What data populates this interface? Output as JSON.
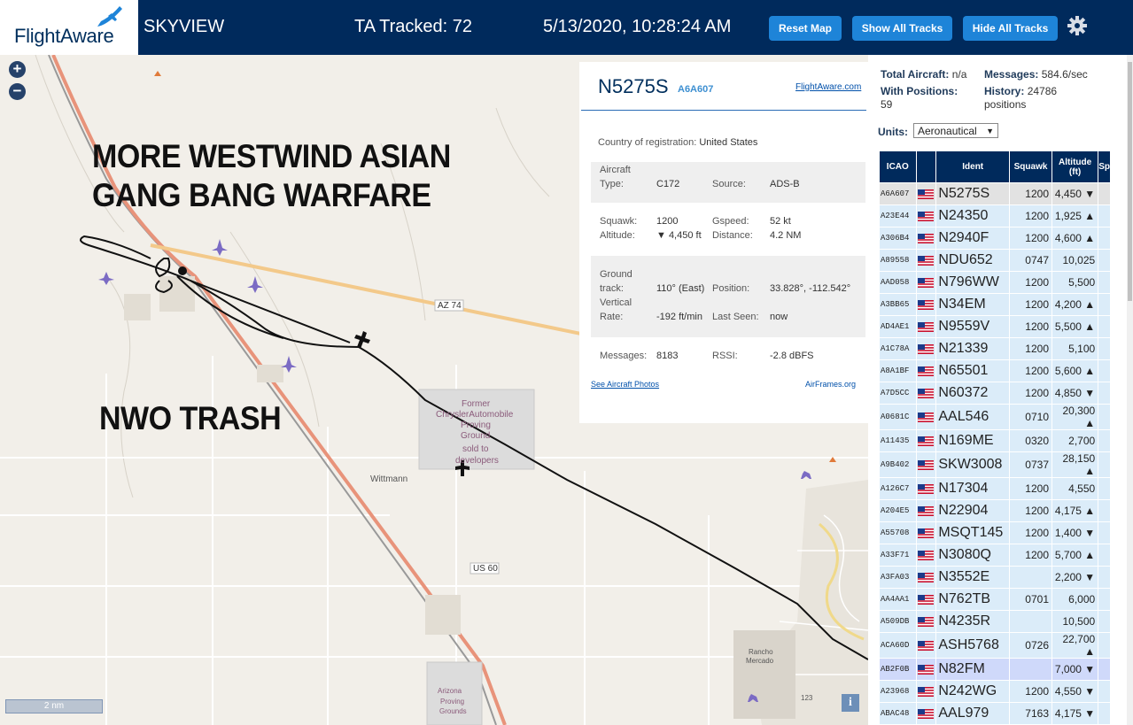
{
  "header": {
    "logo_text": "FlightAware",
    "app_name": "SKYVIEW",
    "tracked": "TA Tracked: 72",
    "datetime": "5/13/2020, 10:28:24 AM",
    "btn_reset": "Reset Map",
    "btn_show": "Show All Tracks",
    "btn_hide": "Hide All Tracks"
  },
  "map": {
    "overlay_line1": "MORE WESTWIND ASIAN",
    "overlay_line2": "GANG BANG WARFARE",
    "overlay_line3": "NWO TRASH",
    "labels": {
      "az74": "AZ 74",
      "us60": "US 60",
      "wittmann": "Wittmann",
      "former": "Former",
      "chrysler": "ChryslerAutomobile",
      "proving": "Proving",
      "ground": "Ground",
      "sold": "sold to",
      "devs": "developers",
      "rancho": "Rancho",
      "mercado": "Mercado",
      "arizona": "Arizona",
      "proving2": "Proving",
      "grounds": "Grounds",
      "rt123": "123"
    },
    "scale": "2 nm",
    "zoom_in": "+",
    "zoom_out": "−",
    "info": "i"
  },
  "detail": {
    "callsign": "N5275S",
    "hex": "A6A607",
    "fa_link": "FlightAware.com",
    "country_lbl": "Country of registration:",
    "country": "United States",
    "aircraft_lbl": "Aircraft",
    "type_lbl": "Type:",
    "type": "C172",
    "source_lbl": "Source:",
    "source": "ADS-B",
    "squawk_lbl": "Squawk:",
    "squawk": "1200",
    "gspeed_lbl": "Gspeed:",
    "gspeed": "52 kt",
    "altitude_lbl": "Altitude:",
    "altitude": "▼ 4,450 ft",
    "distance_lbl": "Distance:",
    "distance": "4.2 NM",
    "ground_lbl": "Ground",
    "track_lbl": "track:",
    "track": "110° (East)",
    "position_lbl": "Position:",
    "position": "33.828°, -112.542°",
    "vertical_lbl": "Vertical",
    "rate_lbl": "Rate:",
    "rate": "-192 ft/min",
    "lastseen_lbl": "Last Seen:",
    "lastseen": "now",
    "messages_lbl": "Messages:",
    "messages": "8183",
    "rssi_lbl": "RSSI:",
    "rssi": "-2.8 dBFS",
    "photos_link": "See Aircraft Photos",
    "airframes_link": "AirFrames.org"
  },
  "stats": {
    "total_lbl": "Total Aircraft:",
    "total": "n/a",
    "withpos_lbl": "With Positions:",
    "withpos": "59",
    "messages_lbl": "Messages:",
    "messages": "584.6/sec",
    "history_lbl": "History:",
    "history": "24786",
    "history_unit": "positions"
  },
  "units": {
    "label": "Units:",
    "value": "Aeronautical"
  },
  "table": {
    "headers": {
      "icao": "ICAO",
      "ident": "Ident",
      "squawk": "Squawk",
      "alt1": "Altitude",
      "alt2": "(ft)",
      "sp": "Sp"
    },
    "rows": [
      {
        "icao": "A6A607",
        "ident": "N5275S",
        "squawk": "1200",
        "alt": "4,450 ▼",
        "state": "selected"
      },
      {
        "icao": "A23E44",
        "ident": "N24350",
        "squawk": "1200",
        "alt": "1,925 ▲",
        "state": ""
      },
      {
        "icao": "A306B4",
        "ident": "N2940F",
        "squawk": "1200",
        "alt": "4,600 ▲",
        "state": ""
      },
      {
        "icao": "A89558",
        "ident": "NDU652",
        "squawk": "0747",
        "alt": "10,025",
        "state": ""
      },
      {
        "icao": "AAD058",
        "ident": "N796WW",
        "squawk": "1200",
        "alt": "5,500",
        "state": ""
      },
      {
        "icao": "A3BB65",
        "ident": "N34EM",
        "squawk": "1200",
        "alt": "4,200 ▲",
        "state": ""
      },
      {
        "icao": "AD4AE1",
        "ident": "N9559V",
        "squawk": "1200",
        "alt": "5,500 ▲",
        "state": ""
      },
      {
        "icao": "A1C78A",
        "ident": "N21339",
        "squawk": "1200",
        "alt": "5,100",
        "state": ""
      },
      {
        "icao": "A8A1BF",
        "ident": "N65501",
        "squawk": "1200",
        "alt": "5,600 ▲",
        "state": ""
      },
      {
        "icao": "A7D5CC",
        "ident": "N60372",
        "squawk": "1200",
        "alt": "4,850 ▼",
        "state": ""
      },
      {
        "icao": "A0681C",
        "ident": "AAL546",
        "squawk": "0710",
        "alt": "20,300 ▲",
        "state": ""
      },
      {
        "icao": "A11435",
        "ident": "N169ME",
        "squawk": "0320",
        "alt": "2,700",
        "state": ""
      },
      {
        "icao": "A9B402",
        "ident": "SKW3008",
        "squawk": "0737",
        "alt": "28,150 ▲",
        "state": ""
      },
      {
        "icao": "A126C7",
        "ident": "N17304",
        "squawk": "1200",
        "alt": "4,550",
        "state": ""
      },
      {
        "icao": "A204E5",
        "ident": "N22904",
        "squawk": "1200",
        "alt": "4,175 ▲",
        "state": ""
      },
      {
        "icao": "A55708",
        "ident": "MSQT145",
        "squawk": "1200",
        "alt": "1,400 ▼",
        "state": ""
      },
      {
        "icao": "A33F71",
        "ident": "N3080Q",
        "squawk": "1200",
        "alt": "5,700 ▲",
        "state": ""
      },
      {
        "icao": "A3FA03",
        "ident": "N3552E",
        "squawk": "",
        "alt": "2,200 ▼",
        "state": ""
      },
      {
        "icao": "AA4AA1",
        "ident": "N762TB",
        "squawk": "0701",
        "alt": "6,000",
        "state": ""
      },
      {
        "icao": "A509DB",
        "ident": "N4235R",
        "squawk": "",
        "alt": "10,500",
        "state": ""
      },
      {
        "icao": "ACA60D",
        "ident": "ASH5768",
        "squawk": "0726",
        "alt": "22,700 ▲",
        "state": ""
      },
      {
        "icao": "AB2F0B",
        "ident": "N82FM",
        "squawk": "",
        "alt": "7,000 ▼",
        "state": "hl"
      },
      {
        "icao": "A23968",
        "ident": "N242WG",
        "squawk": "1200",
        "alt": "4,550 ▼",
        "state": ""
      },
      {
        "icao": "ABAC48",
        "ident": "AAL979",
        "squawk": "7163",
        "alt": "4,175 ▼",
        "state": ""
      }
    ]
  },
  "colors": {
    "header_bg": "#002a5c",
    "button": "#1e84d8",
    "row_bg": "#dbecf9",
    "selected": "#e2e2e2",
    "highlight": "#cfd9fa"
  }
}
